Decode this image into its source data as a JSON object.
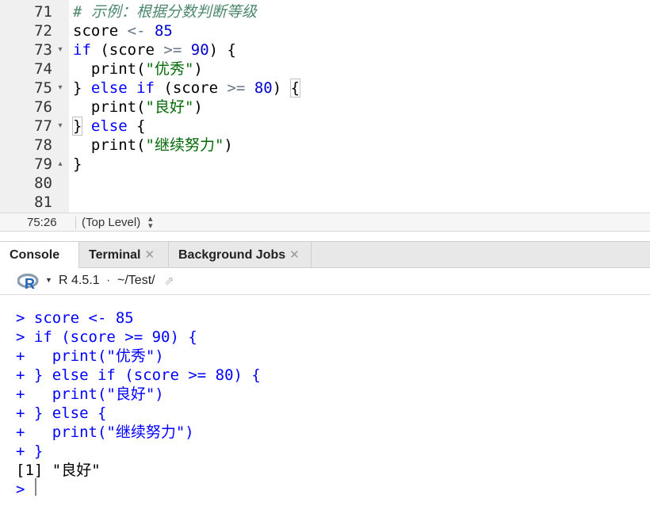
{
  "editor": {
    "lines": [
      {
        "num": "71",
        "fold": "",
        "tokens": [
          {
            "t": "# 示例：根据分数判断等级",
            "c": "cmt"
          }
        ]
      },
      {
        "num": "72",
        "fold": "",
        "tokens": [
          {
            "t": "score ",
            "c": ""
          },
          {
            "t": "<-",
            "c": "op"
          },
          {
            "t": " ",
            "c": ""
          },
          {
            "t": "85",
            "c": "num"
          }
        ]
      },
      {
        "num": "73",
        "fold": "▾",
        "tokens": [
          {
            "t": "if",
            "c": "kw"
          },
          {
            "t": " (score ",
            "c": ""
          },
          {
            "t": ">=",
            "c": "op"
          },
          {
            "t": " ",
            "c": ""
          },
          {
            "t": "90",
            "c": "num"
          },
          {
            "t": ") {",
            "c": ""
          }
        ]
      },
      {
        "num": "74",
        "fold": "",
        "tokens": [
          {
            "t": "  print(",
            "c": ""
          },
          {
            "t": "\"优秀\"",
            "c": "str"
          },
          {
            "t": ")",
            "c": ""
          }
        ]
      },
      {
        "num": "75",
        "fold": "▾",
        "tokens": [
          {
            "t": "} ",
            "c": ""
          },
          {
            "t": "else if",
            "c": "kw"
          },
          {
            "t": " (score ",
            "c": ""
          },
          {
            "t": ">=",
            "c": "op"
          },
          {
            "t": " ",
            "c": ""
          },
          {
            "t": "80",
            "c": "num"
          },
          {
            "t": ") ",
            "c": ""
          },
          {
            "t": "{",
            "c": "bm"
          }
        ]
      },
      {
        "num": "76",
        "fold": "",
        "tokens": [
          {
            "t": "  print(",
            "c": ""
          },
          {
            "t": "\"良好\"",
            "c": "str"
          },
          {
            "t": ")",
            "c": ""
          }
        ]
      },
      {
        "num": "77",
        "fold": "▾",
        "tokens": [
          {
            "t": "}",
            "c": "bm"
          },
          {
            "t": " ",
            "c": ""
          },
          {
            "t": "else",
            "c": "kw"
          },
          {
            "t": " {",
            "c": ""
          }
        ]
      },
      {
        "num": "78",
        "fold": "",
        "tokens": [
          {
            "t": "  print(",
            "c": ""
          },
          {
            "t": "\"继续努力\"",
            "c": "str"
          },
          {
            "t": ")",
            "c": ""
          }
        ]
      },
      {
        "num": "79",
        "fold": "▴",
        "tokens": [
          {
            "t": "}",
            "c": ""
          }
        ]
      },
      {
        "num": "80",
        "fold": "",
        "tokens": []
      },
      {
        "num": "81",
        "fold": "",
        "tokens": []
      }
    ]
  },
  "statusbar": {
    "cursor_position": "75:26",
    "scope": "(Top Level)",
    "scope_icon": "up-down-arrows-icon"
  },
  "console_tabs": [
    {
      "label": "Console",
      "closable": false,
      "active": true
    },
    {
      "label": "Terminal",
      "closable": true,
      "active": false
    },
    {
      "label": "Background Jobs",
      "closable": true,
      "active": false
    }
  ],
  "console_header": {
    "r_version": "R 4.5.1",
    "separator": "·",
    "working_dir": "~/Test/",
    "go_icon": "go-to-directory-icon"
  },
  "console_lines": [
    {
      "prompt": ">",
      "text": " score <- 85",
      "kind": "input"
    },
    {
      "prompt": ">",
      "text": " if (score >= 90) {",
      "kind": "input"
    },
    {
      "prompt": "+",
      "text": "   print(\"优秀\")",
      "kind": "input"
    },
    {
      "prompt": "+",
      "text": " } else if (score >= 80) {",
      "kind": "input"
    },
    {
      "prompt": "+",
      "text": "   print(\"良好\")",
      "kind": "input"
    },
    {
      "prompt": "+",
      "text": " } else {",
      "kind": "input"
    },
    {
      "prompt": "+",
      "text": "   print(\"继续努力\")",
      "kind": "input"
    },
    {
      "prompt": "+",
      "text": " }",
      "kind": "input"
    },
    {
      "prompt": "",
      "text": "[1] \"良好\"",
      "kind": "output"
    },
    {
      "prompt": ">",
      "text": "",
      "kind": "input"
    }
  ],
  "colors": {
    "keyword": "#0000ff",
    "number": "#0000cd",
    "string": "#036a07",
    "comment": "#4c886b",
    "gutter_bg": "#f0f0f0",
    "tab_bar_bg": "#e8e8e8"
  }
}
